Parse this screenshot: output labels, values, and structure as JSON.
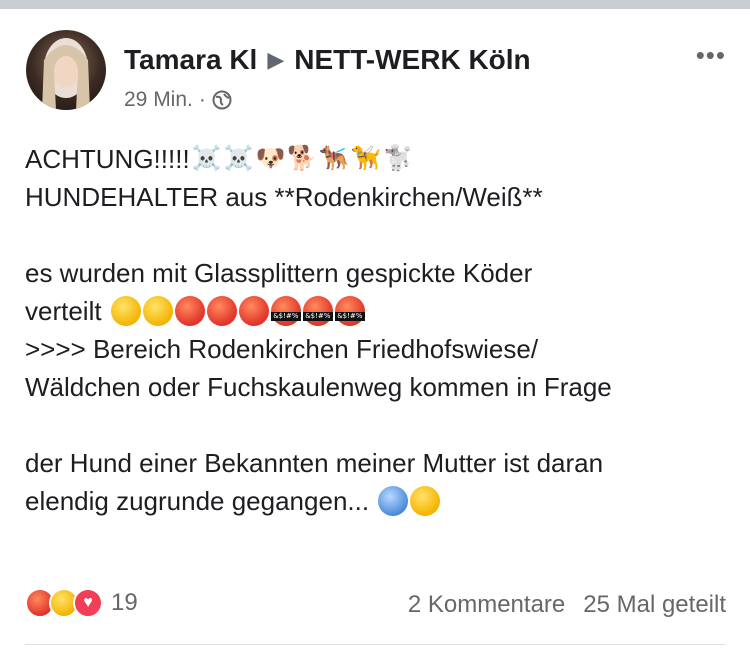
{
  "post": {
    "author": "Tamara Kl",
    "group": "NETT-WERK Köln",
    "time": "29 Min.",
    "separator": "·",
    "privacy_icon": "globe-icon",
    "more_icon": "more-options-icon",
    "lines": [
      {
        "text": "ACHTUNG!!!!!",
        "emojis": [
          "☠️",
          "☠️",
          "🐶",
          "🐕",
          "🐕‍🦺",
          "🦮",
          "🐩"
        ]
      },
      {
        "text": "HUNDEHALTER aus **Rodenkirchen/Weiß**"
      },
      {
        "text": "es wurden mit Glassplittern gespickte Köder"
      },
      {
        "text": "verteilt"
      },
      {
        "text": ">>>> Bereich Rodenkirchen Friedhofswiese/"
      },
      {
        "text": "Wäldchen oder Fuchskaulenweg kommen in Frage"
      },
      {
        "text": "der Hund einer Bekannten meiner Mutter ist daran"
      },
      {
        "text": "elendig zugrunde gegangen..."
      }
    ]
  },
  "footer": {
    "reactions": [
      "angry",
      "sad",
      "care"
    ],
    "reaction_count": "19",
    "comments": "2 Kommentare",
    "shares": "25 Mal geteilt"
  }
}
